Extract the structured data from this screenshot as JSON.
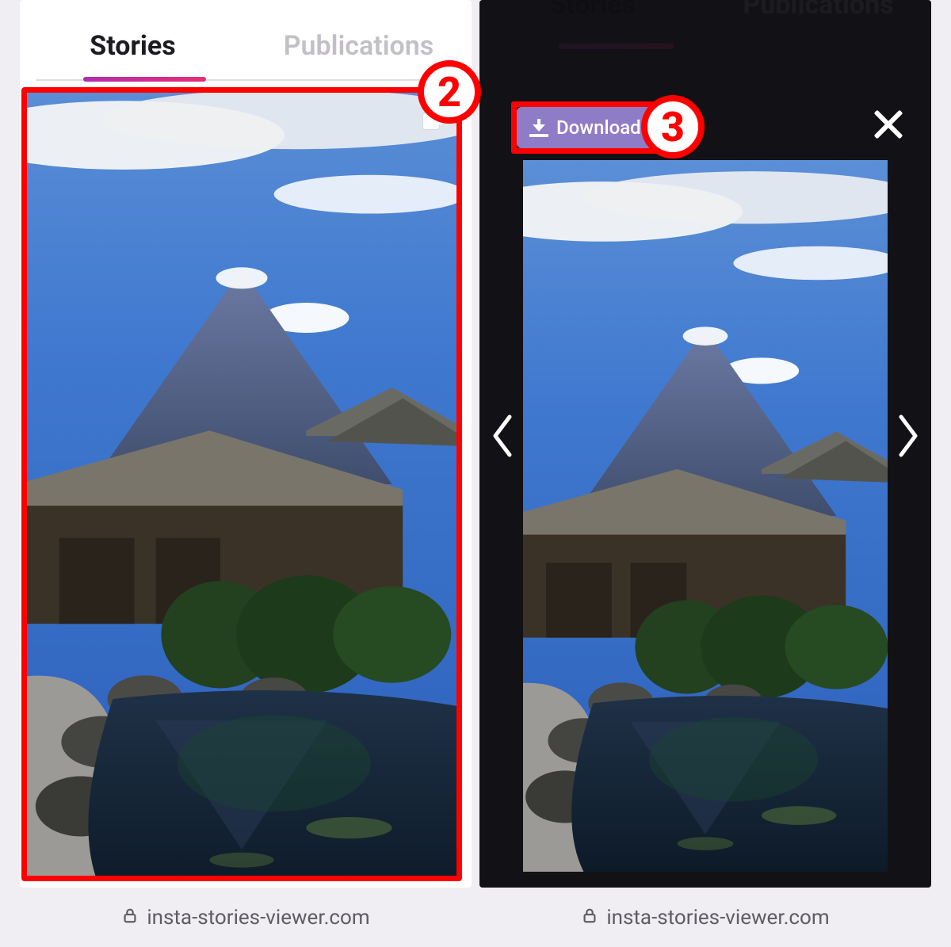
{
  "tabs": {
    "stories_label": "Stories",
    "publications_label": "Publications"
  },
  "modal": {
    "download_label": "Download"
  },
  "footer": {
    "domain": "insta-stories-viewer.com"
  },
  "annotations": {
    "step2": "2",
    "step3": "3"
  },
  "colors": {
    "highlight": "#ff0000",
    "download_button": "#8f7cc7",
    "tab_indicator_start": "#b32db0",
    "tab_indicator_end": "#e62e73"
  }
}
